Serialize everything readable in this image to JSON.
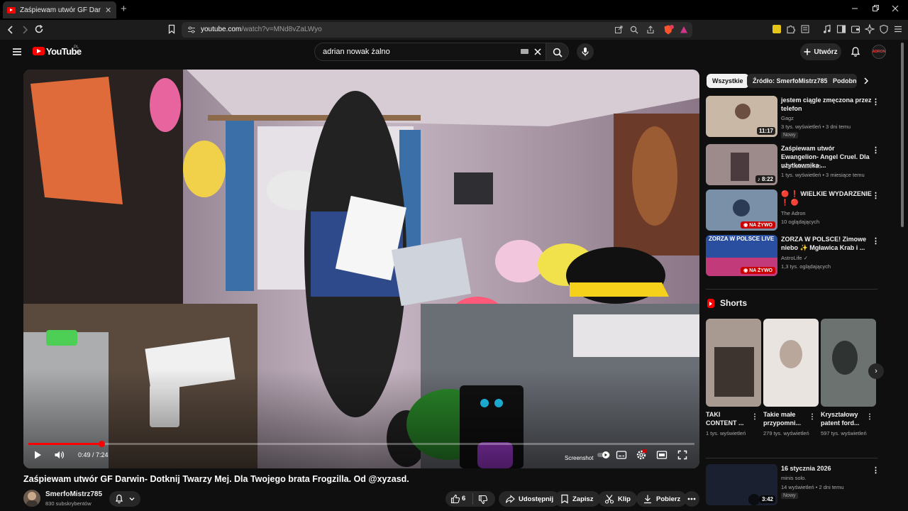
{
  "browser": {
    "tab_title": "Zaśpiewam utwór GF Darwin- D",
    "tab_close": "✕",
    "new_tab": "+",
    "url_host": "youtube.com",
    "url_path": "/watch?v=MNd8vZaLWyo"
  },
  "header": {
    "logo_text": "YouTube",
    "country_code": "PL",
    "search_query": "adrian nowak żalno",
    "create_label": "Utwórz",
    "avatar_text": "ADRON"
  },
  "player": {
    "time": "0:49 / 7:24",
    "progress_fraction": 0.11,
    "screenshot_label": "Screenshot"
  },
  "video": {
    "title": "Zaśpiewam utwór GF Darwin- Dotknij Twarzy Mej. Dla Twojego brata Frogzilla. Od @xyzasd.",
    "channel_name": "SmerfoMistrz785",
    "subscribers": "830 subskrybentów",
    "like_count": "6",
    "share_label": "Udostępnij",
    "save_label": "Zapisz",
    "clip_label": "Klip",
    "download_label": "Pobierz"
  },
  "chips": [
    "Wszystkie",
    "Źródło: SmerfoMistrz785",
    "Podobne"
  ],
  "recommendations": [
    {
      "title": "jestem ciągle zmęczona przez telefon",
      "channel": "Gagz",
      "meta": "3 tys. wyświetleń • 3 dni temu",
      "badge": "Nowy",
      "duration": "11:17",
      "live": "",
      "colors": [
        "#c9b8a6",
        "#6d4f42"
      ]
    },
    {
      "title": "Zaśpiewam utwór Ewangelion- Angel Cruel. Dla użytkownika ...",
      "channel": "SmerfoMistrz785",
      "meta": "1 tys. wyświetleń • 3 miesiące temu",
      "badge": "",
      "duration": "8:22",
      "live": "",
      "colors": [
        "#9d8a8a",
        "#4b3b3e"
      ]
    },
    {
      "title": "🔴 ❗ WIELKIE WYDARZENIE ❗ 🔴",
      "channel": "The Adron",
      "meta": "10 oglądających",
      "badge": "",
      "duration": "",
      "live": "NA ŻYWO",
      "colors": [
        "#7a8fa8",
        "#2b3a55"
      ]
    },
    {
      "title": "ZORZA W POLSCE! Zimowe niebo ✨ Mgławica Krab i ...",
      "channel": "AstroLife",
      "meta": "1,3 tys. oglądających",
      "badge": "",
      "duration": "",
      "live": "NA ŻYWO",
      "overlay": "ZORZA W POLSCE LIVE",
      "colors": [
        "#2a4fa0",
        "#c23a7a"
      ]
    },
    {
      "title": "16 stycznia 2026",
      "channel": "minis solo.",
      "meta": "14 wyświetleń • 2 dni temu",
      "badge": "Nowy",
      "duration": "3:42",
      "live": "",
      "colors": [
        "#1b2030",
        "#0a0c12"
      ]
    }
  ],
  "shorts": {
    "heading": "Shorts",
    "items": [
      {
        "title": "TAKI CONTENT ...",
        "views": "1 tys. wyświetleń",
        "colors": [
          "#a89a90",
          "#3d3430"
        ]
      },
      {
        "title": "Takie małe przypomni...",
        "views": "279 tys. wyświetleń",
        "colors": [
          "#e9e4e0",
          "#b9a79b"
        ]
      },
      {
        "title": "Kryształowy patent ford...",
        "views": "597 tys. wyświetleń",
        "colors": [
          "#6b7270",
          "#2f3433"
        ]
      }
    ]
  },
  "icons": {
    "back": "back-arrow-icon",
    "forward": "forward-arrow-icon",
    "reload": "reload-icon",
    "bookmark": "bookmark-icon",
    "menu": "hamburger-icon",
    "search": "search-icon",
    "mic": "mic-icon",
    "bell": "bell-icon"
  },
  "colors": {
    "brand_red": "#ff0000",
    "background": "#0f0f0f",
    "pill_bg": "#272727",
    "live_red": "#cc0000"
  }
}
